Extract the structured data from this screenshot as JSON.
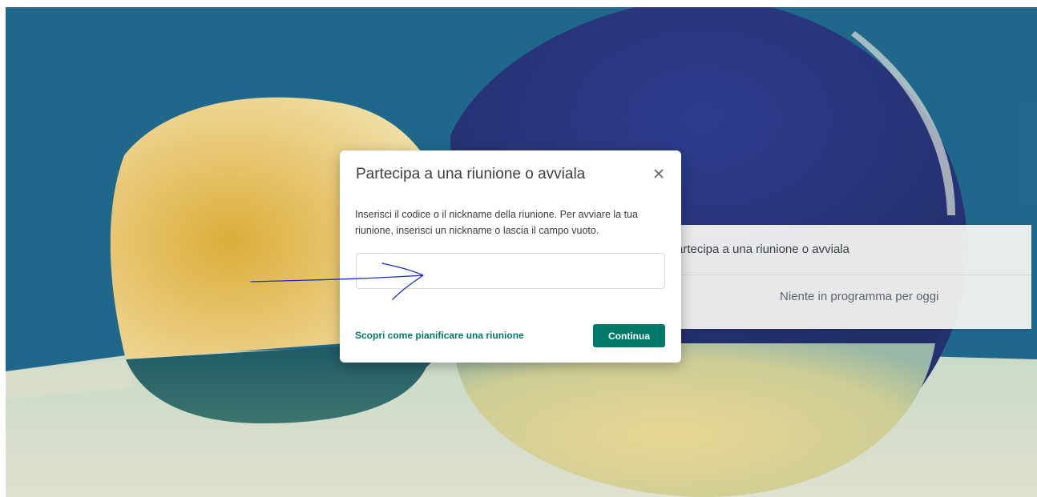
{
  "dialog": {
    "title": "Partecipa a una riunione o avviala",
    "description": "Inserisci il codice o il nickname della riunione. Per avviare la tua riunione, inserisci un nickname o lascia il campo vuoto.",
    "input_value": "",
    "input_placeholder": "",
    "learn_link": "Scopri come pianificare una riunione",
    "continue_label": "Continua",
    "close_icon": "close-icon"
  },
  "side_card": {
    "title": "artecipa a una riunione o avviala",
    "empty_text": "Niente in programma per oggi"
  },
  "colors": {
    "accent": "#00796b",
    "annotation": "#1a2bd6"
  }
}
